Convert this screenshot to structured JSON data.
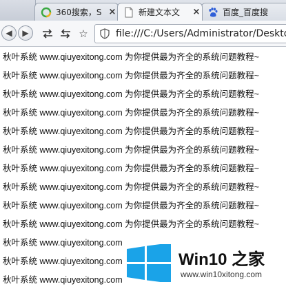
{
  "browser": {
    "tabs": [
      {
        "label": "360搜索，S",
        "icon": "360-search-icon",
        "close": "×"
      },
      {
        "label": "新建文本文",
        "icon": "document-icon",
        "close": "×",
        "active": true
      },
      {
        "label": "百度_百度搜",
        "icon": "baidu-paw-icon",
        "close": "×"
      }
    ],
    "address": {
      "url": "file:///C:/Users/Administrator/Desktop"
    },
    "toolbar": {
      "back_icon": "back-arrow-icon",
      "forward_icon": "forward-arrow-icon",
      "star": "☆"
    }
  },
  "page": {
    "lines": [
      "秋叶系统 www.qiuyexitong.com 为你提供最为齐全的系统问题教程~",
      "秋叶系统 www.qiuyexitong.com 为你提供最为齐全的系统问题教程~",
      "秋叶系统 www.qiuyexitong.com 为你提供最为齐全的系统问题教程~",
      "秋叶系统 www.qiuyexitong.com 为你提供最为齐全的系统问题教程~",
      "秋叶系统 www.qiuyexitong.com 为你提供最为齐全的系统问题教程~",
      "秋叶系统 www.qiuyexitong.com 为你提供最为齐全的系统问题教程~",
      "秋叶系统 www.qiuyexitong.com 为你提供最为齐全的系统问题教程~",
      "秋叶系统 www.qiuyexitong.com 为你提供最为齐全的系统问题教程~",
      "秋叶系统 www.qiuyexitong.com 为你提供最为齐全的系统问题教程~",
      "秋叶系统 www.qiuyexitong.com 为你提供最为齐全的系统问题教程~",
      "秋叶系统 www.qiuyexitong.com",
      "秋叶系统 www.qiuyexitong.com",
      "秋叶系统 www.qiuyexitong.com"
    ]
  },
  "watermark": {
    "brand": "Win10 之家",
    "url": "www.win10xitong.com",
    "logo_color": "#1aa3e8"
  }
}
